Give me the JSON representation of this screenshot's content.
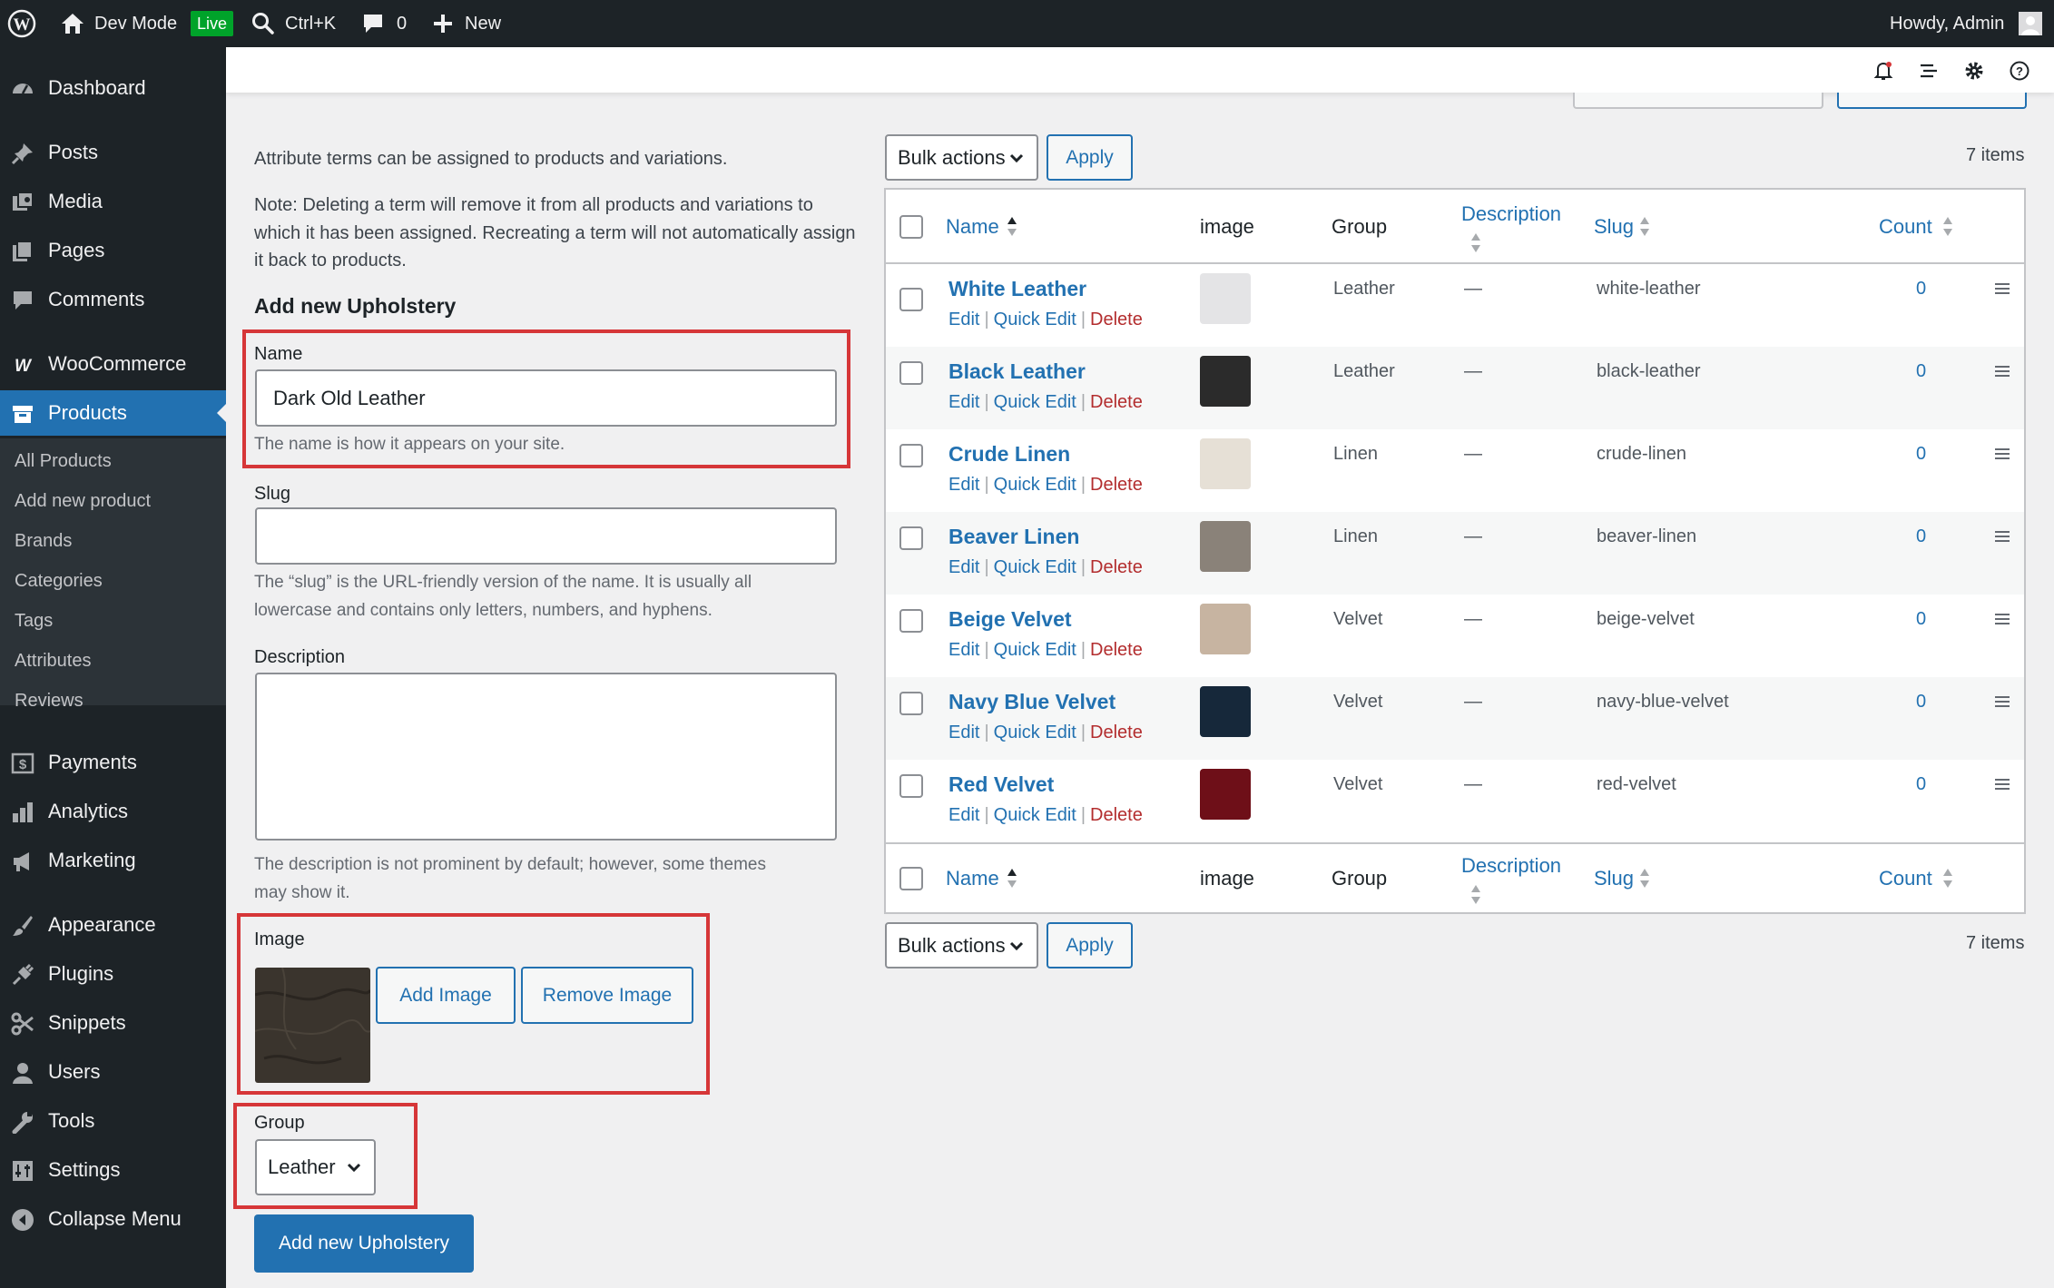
{
  "adminbar": {
    "site": "Dev Mode",
    "live": "Live",
    "search": "Ctrl+K",
    "comments": "0",
    "new": "New",
    "howdy": "Howdy, Admin"
  },
  "sidebar": {
    "items": [
      {
        "label": "Dashboard"
      },
      {
        "label": "Posts"
      },
      {
        "label": "Media"
      },
      {
        "label": "Pages"
      },
      {
        "label": "Comments"
      },
      {
        "label": "WooCommerce"
      },
      {
        "label": "Products"
      },
      {
        "label": "Payments"
      },
      {
        "label": "Analytics"
      },
      {
        "label": "Marketing"
      },
      {
        "label": "Appearance"
      },
      {
        "label": "Plugins"
      },
      {
        "label": "Snippets"
      },
      {
        "label": "Users"
      },
      {
        "label": "Tools"
      },
      {
        "label": "Settings"
      },
      {
        "label": "Collapse Menu"
      }
    ],
    "submenu": [
      {
        "label": "All Products"
      },
      {
        "label": "Add new product"
      },
      {
        "label": "Brands"
      },
      {
        "label": "Categories"
      },
      {
        "label": "Tags"
      },
      {
        "label": "Attributes"
      },
      {
        "label": "Reviews"
      }
    ]
  },
  "form": {
    "intro": "Attribute terms can be assigned to products and variations.",
    "note_lines": [
      "Note: Deleting a term will remove it from all products and variations to",
      "which it has been assigned. Recreating a term will not automatically assign",
      "it back to products."
    ],
    "heading": "Add new Upholstery",
    "name_label": "Name",
    "name_value": "Dark Old Leather",
    "name_help": "The name is how it appears on your site.",
    "slug_label": "Slug",
    "slug_value": "",
    "slug_help_lines": [
      "The “slug” is the URL-friendly version of the name. It is usually all",
      "lowercase and contains only letters, numbers, and hyphens."
    ],
    "description_label": "Description",
    "description_value": "",
    "description_help_lines": [
      "The description is not prominent by default; however, some themes",
      "may show it."
    ],
    "image_label": "Image",
    "image_color": "#3a342d",
    "add_image": "Add Image",
    "remove_image": "Remove Image",
    "group_label": "Group",
    "group_value": "Leather",
    "submit": "Add new Upholstery"
  },
  "list": {
    "bulk_actions": "Bulk actions",
    "apply": "Apply",
    "items_count": "7 items",
    "columns": {
      "name": "Name",
      "image": "image",
      "group": "Group",
      "description": "Description",
      "slug": "Slug",
      "count": "Count"
    },
    "row_actions": {
      "edit": "Edit",
      "quick_edit": "Quick Edit",
      "delete": "Delete"
    },
    "rows": [
      {
        "name": "White Leather",
        "group": "Leather",
        "description": "—",
        "slug": "white-leather",
        "count": "0",
        "swatch": "#e4e4e6"
      },
      {
        "name": "Black Leather",
        "group": "Leather",
        "description": "—",
        "slug": "black-leather",
        "count": "0",
        "swatch": "#2b2b2b"
      },
      {
        "name": "Crude Linen",
        "group": "Linen",
        "description": "—",
        "slug": "crude-linen",
        "count": "0",
        "swatch": "#e6e0d6"
      },
      {
        "name": "Beaver Linen",
        "group": "Linen",
        "description": "—",
        "slug": "beaver-linen",
        "count": "0",
        "swatch": "#8a8279"
      },
      {
        "name": "Beige Velvet",
        "group": "Velvet",
        "description": "—",
        "slug": "beige-velvet",
        "count": "0",
        "swatch": "#c7b4a1"
      },
      {
        "name": "Navy Blue Velvet",
        "group": "Velvet",
        "description": "—",
        "slug": "navy-blue-velvet",
        "count": "0",
        "swatch": "#16283a"
      },
      {
        "name": "Red Velvet",
        "group": "Velvet",
        "description": "—",
        "slug": "red-velvet",
        "count": "0",
        "swatch": "#6e0f18"
      }
    ]
  }
}
